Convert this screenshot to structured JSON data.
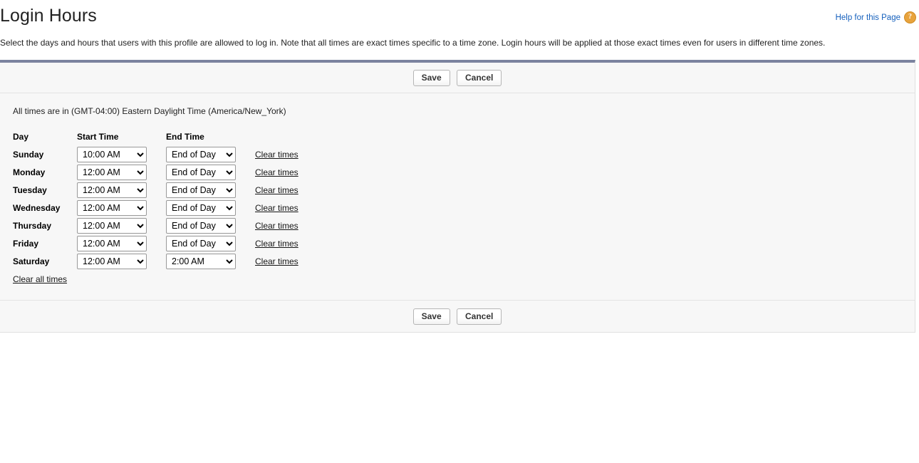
{
  "header": {
    "title": "Login Hours",
    "help_label": "Help for this Page",
    "help_icon_glyph": "?",
    "help_link_color": "#1560bd",
    "help_icon_color": "#e8a33d"
  },
  "description": "Select the days and hours that users with this profile are allowed to log in. Note that all times are exact times specific to a time zone. Login hours will be applied at those exact times even for users in different time zones.",
  "panel": {
    "accent_bar_color": "#7b839f",
    "background_color": "#f7f7f7"
  },
  "toolbar": {
    "save_label": "Save",
    "cancel_label": "Cancel"
  },
  "timezone_note": "All times are in (GMT-04:00) Eastern Daylight Time (America/New_York)",
  "table": {
    "headers": {
      "day": "Day",
      "start_time": "Start Time",
      "end_time": "End Time"
    },
    "clear_link_label": "Clear times",
    "clear_all_label": "Clear all times",
    "rows": [
      {
        "day": "Sunday",
        "start": "10:00 AM",
        "end": "End of Day"
      },
      {
        "day": "Monday",
        "start": "12:00 AM",
        "end": "End of Day"
      },
      {
        "day": "Tuesday",
        "start": "12:00 AM",
        "end": "End of Day"
      },
      {
        "day": "Wednesday",
        "start": "12:00 AM",
        "end": "End of Day"
      },
      {
        "day": "Thursday",
        "start": "12:00 AM",
        "end": "End of Day"
      },
      {
        "day": "Friday",
        "start": "12:00 AM",
        "end": "End of Day"
      },
      {
        "day": "Saturday",
        "start": "12:00 AM",
        "end": "2:00 AM"
      }
    ]
  }
}
